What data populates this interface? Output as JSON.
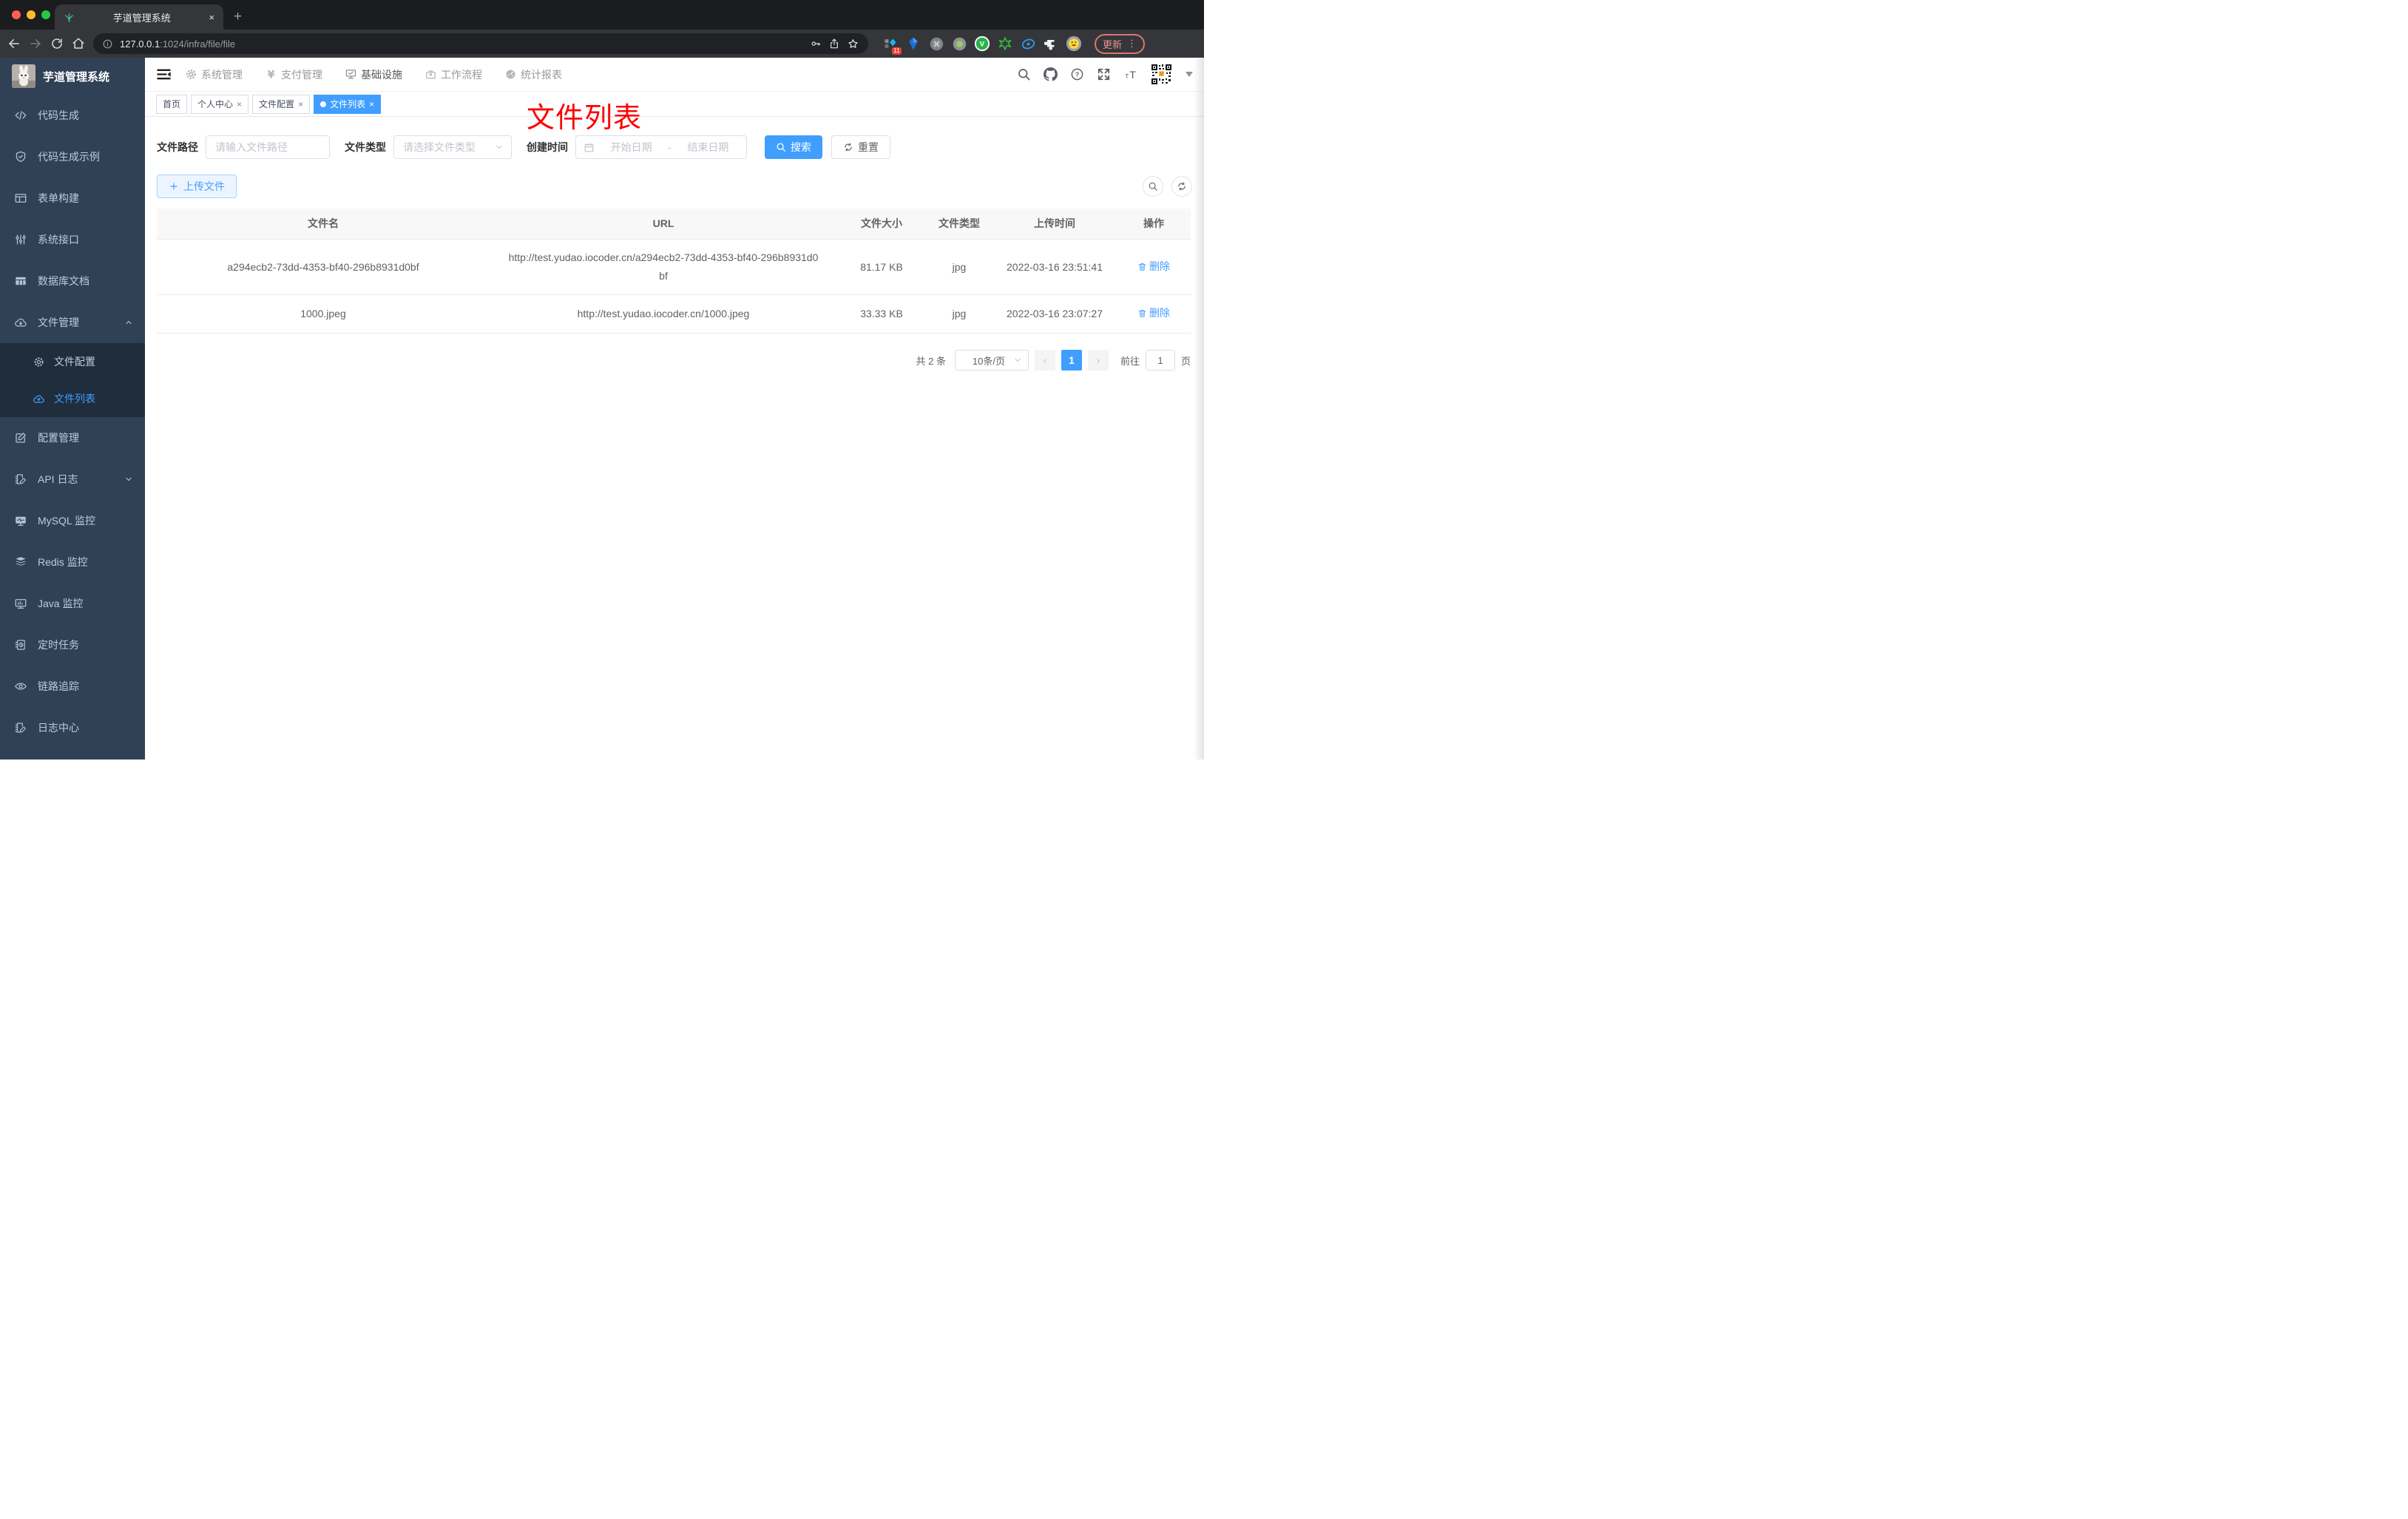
{
  "browser": {
    "tab_title": "芋道管理系统",
    "new_tab_glyph": "+",
    "close_glyph": "×",
    "url_host": "127.0.0.1",
    "url_path": ":1024/infra/file/file",
    "extension_badge": "11",
    "update_label": "更新",
    "menu_dots": "⋮"
  },
  "sidebar": {
    "title": "芋道管理系统",
    "items": [
      {
        "label": "代码生成",
        "icon": "code-icon"
      },
      {
        "label": "代码生成示例",
        "icon": "shield-check-icon"
      },
      {
        "label": "表单构建",
        "icon": "form-icon"
      },
      {
        "label": "系统接口",
        "icon": "sliders-icon"
      },
      {
        "label": "数据库文档",
        "icon": "table-filled-icon"
      },
      {
        "label": "文件管理",
        "icon": "cloud-download-icon",
        "state": "expanded"
      },
      {
        "label": "文件配置",
        "icon": "gear-icon",
        "submenu": true
      },
      {
        "label": "文件列表",
        "icon": "cloud-upload-icon",
        "submenu": true,
        "active": true
      },
      {
        "label": "配置管理",
        "icon": "edit-square-icon"
      },
      {
        "label": "API 日志",
        "icon": "log-edit-icon",
        "state": "collapsed"
      },
      {
        "label": "MySQL 监控",
        "icon": "monitor-pulse-icon"
      },
      {
        "label": "Redis 监控",
        "icon": "layers-icon"
      },
      {
        "label": "Java 监控",
        "icon": "monitor-bars-icon"
      },
      {
        "label": "定时任务",
        "icon": "schedule-icon"
      },
      {
        "label": "链路追踪",
        "icon": "eye-icon"
      },
      {
        "label": "日志中心",
        "icon": "log-edit-icon"
      }
    ]
  },
  "topnav": {
    "items": [
      {
        "label": "系统管理",
        "icon": "gear-filled-icon"
      },
      {
        "label": "支付管理",
        "icon": "yen-icon"
      },
      {
        "label": "基础设施",
        "icon": "monitor-check-icon",
        "active": true
      },
      {
        "label": "工作流程",
        "icon": "briefcase-icon"
      },
      {
        "label": "统计报表",
        "icon": "dashboard-icon"
      }
    ]
  },
  "tabs": [
    {
      "label": "首页"
    },
    {
      "label": "个人中心",
      "closable": true
    },
    {
      "label": "文件配置",
      "closable": true
    },
    {
      "label": "文件列表",
      "closable": true,
      "active": true
    }
  ],
  "annotation": "文件列表",
  "filters": {
    "path_label": "文件路径",
    "path_placeholder": "请输入文件路径",
    "type_label": "文件类型",
    "type_placeholder": "请选择文件类型",
    "date_label": "创建时间",
    "date_start": "开始日期",
    "date_separator": "-",
    "date_end": "结束日期",
    "search_label": "搜索",
    "reset_label": "重置"
  },
  "actions": {
    "upload_label": "上传文件"
  },
  "table": {
    "headers": [
      "文件名",
      "URL",
      "文件大小",
      "文件类型",
      "上传时间",
      "操作"
    ],
    "rows": [
      {
        "name": "a294ecb2-73dd-4353-bf40-296b8931d0bf",
        "url": "http://test.yudao.iocoder.cn/a294ecb2-73dd-4353-bf40-296b8931d0bf",
        "size": "81.17 KB",
        "type": "jpg",
        "time": "2022-03-16 23:51:41",
        "action": "删除"
      },
      {
        "name": "1000.jpeg",
        "url": "http://test.yudao.iocoder.cn/1000.jpeg",
        "size": "33.33 KB",
        "type": "jpg",
        "time": "2022-03-16 23:07:27",
        "action": "删除"
      }
    ]
  },
  "pagination": {
    "total": "共 2 条",
    "page_size": "10条/页",
    "prev_glyph": "‹",
    "page": "1",
    "next_glyph": "›",
    "goto_label": "前往",
    "goto_value": "1",
    "goto_unit": "页"
  },
  "colors": {
    "primary": "#409EFF",
    "sidebar_bg": "#304156",
    "submenu_bg": "#1F2D3D",
    "annotation_red": "#FB0300",
    "table_header_bg": "#F8F8F9"
  }
}
